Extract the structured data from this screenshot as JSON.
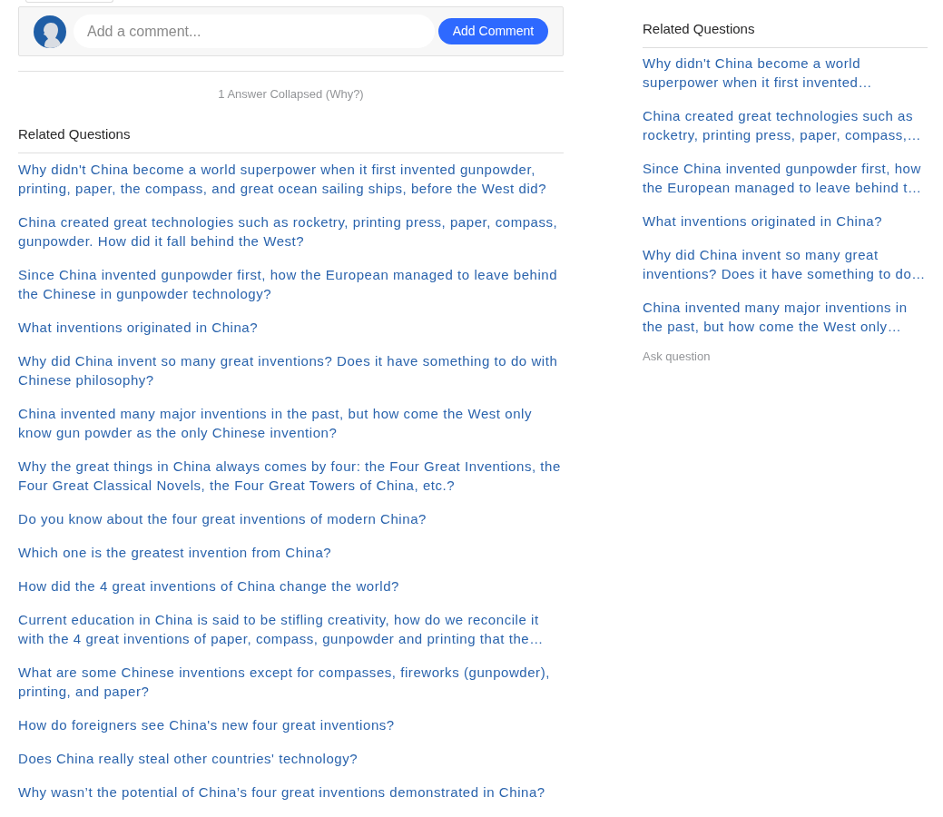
{
  "comment_box": {
    "placeholder": "Add a comment...",
    "button": "Add Comment"
  },
  "collapsed_note": "1 Answer Collapsed (Why?)",
  "related_questions": {
    "title": "Related Questions",
    "items": [
      "Why didn't China become a world superpower when it first invented gunpowder, printing, paper, the compass, and great ocean sailing ships, before the West did?",
      "China created great technologies such as rocketry, printing press, paper, compass, gunpowder. How did it fall behind the West?",
      "Since China invented gunpowder first, how the European managed to leave behind the Chinese in gunpowder technology?",
      "What inventions originated in China?",
      "Why did China invent so many great inventions? Does it have something to do with Chinese philosophy?",
      "China invented many major inventions in the past, but how come the West only know gun powder as the only Chinese invention?",
      "Why the great things in China always comes by four: the Four Great Inventions, the Four Great Classical Novels, the Four Great Towers of China, etc.?",
      "Do you know about the four great inventions of modern China?",
      "Which one is the greatest invention from China?",
      "How did the 4 great inventions of China change the world?",
      "Current education in China is said to be stifling creativity, how do we reconcile it with the 4 great inventions of paper, compass, gunpowder and printing that the…",
      "What are some Chinese inventions except for compasses, fireworks (gunpowder), printing, and paper?",
      "How do foreigners see China's new four great inventions?",
      "Does China really steal other countries' technology?",
      "Why wasn’t the potential of China’s four great inventions demonstrated in China?"
    ]
  },
  "sidebar": {
    "title": "Related Questions",
    "items": [
      "Why didn't China become a world superpower when it first invented…",
      "China created great technologies such as rocketry, printing press, paper, compass,…",
      "Since China invented gunpowder first, how the European managed to leave behind t…",
      "What inventions originated in China?",
      "Why did China invent so many great inventions? Does it have something to do…",
      "China invented many major inventions in the past, but how come the West only…"
    ],
    "ask_link": "Ask question"
  }
}
